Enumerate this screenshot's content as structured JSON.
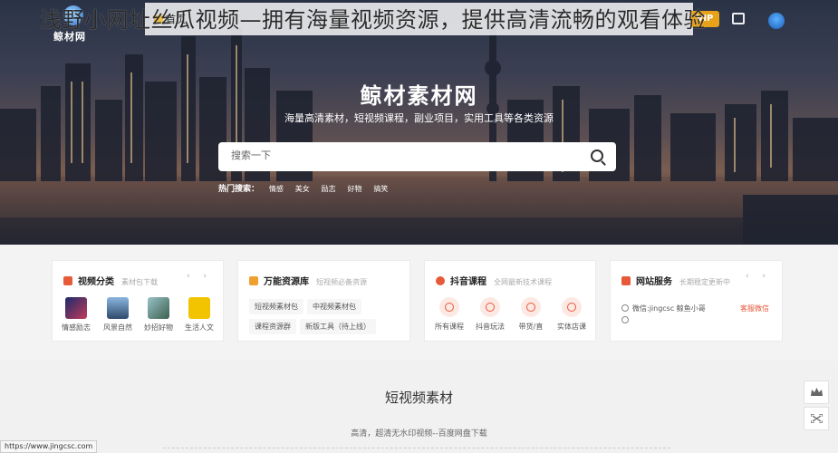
{
  "overlay_title": "浅野小网址丝瓜视频—拥有海量视频资源，提供高清流畅的观看体验",
  "header": {
    "logo_text": "鲸材网",
    "nav_home": "首页",
    "vip_label": "VIP"
  },
  "hero": {
    "brand": "鲸材素材网",
    "slogan": "海量高清素材，短视频课程，副业项目，实用工具等各类资源",
    "search_placeholder": "搜索一下",
    "hot_label": "热门搜索：",
    "hot_tags": [
      "情感",
      "美女",
      "励志",
      "好物",
      "搞笑"
    ]
  },
  "cards": {
    "video": {
      "title": "视频分类",
      "subtitle": "素材包下载",
      "items": [
        "情感励志",
        "风景自然",
        "妙招好物",
        "生活人文"
      ]
    },
    "resources": {
      "title": "万能资源库",
      "subtitle": "短视频必备资源",
      "chips": [
        "短视频素材包",
        "中视频素材包",
        "课程资源群",
        "新版工具（待上线）"
      ]
    },
    "douyin": {
      "title": "抖音课程",
      "subtitle": "全网最新技术课程",
      "items": [
        "所有课程",
        "抖音玩法",
        "带货/直",
        "实体店课"
      ]
    },
    "service": {
      "title": "网站服务",
      "subtitle": "长期稳定更新中",
      "line1": "微信:jingcsc 鲸鱼小哥",
      "service_btn": "客服微信"
    }
  },
  "section": {
    "title": "短视频素材",
    "subtitle": "高清，超清无水印视频--百度网盘下载"
  },
  "status_url": "https://www.jingcsc.com",
  "colors": {
    "accent": "#e65a3a",
    "vip": "#e8a21a"
  }
}
